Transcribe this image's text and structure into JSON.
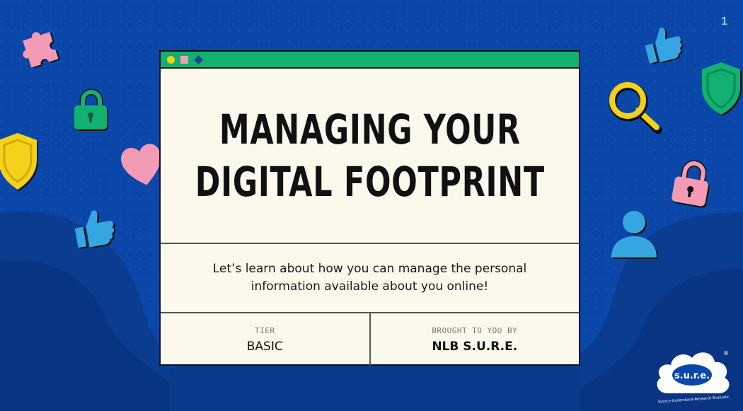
{
  "slide": {
    "number": "1"
  },
  "card": {
    "title_line1": "MANAGING YOUR",
    "title_line2": "DIGITAL FOOTPRINT",
    "subtitle": "Let’s learn about how you can manage the personal information available about you online!",
    "tier_label": "TIER",
    "tier_value": "BASIC",
    "brought_label": "BROUGHT TO YOU BY",
    "brought_value": "NLB S.U.R.E."
  },
  "logo": {
    "wordmark": "s.u.r.e.",
    "tagline": "Source-Understand-Research-Evaluate",
    "registered": "®"
  },
  "decorations": [
    "puzzle-icon",
    "lock-icon",
    "heart-icon",
    "shield-icon",
    "thumbs-up-icon",
    "magnifier-icon",
    "user-icon"
  ],
  "colors": {
    "background": "#0b47a8",
    "card": "#fbf8ec",
    "card_topbar": "#12b071",
    "accent_yellow": "#f4d21b",
    "accent_pink": "#f39bb4",
    "accent_green": "#12b071",
    "accent_cyan": "#36a6e0"
  }
}
